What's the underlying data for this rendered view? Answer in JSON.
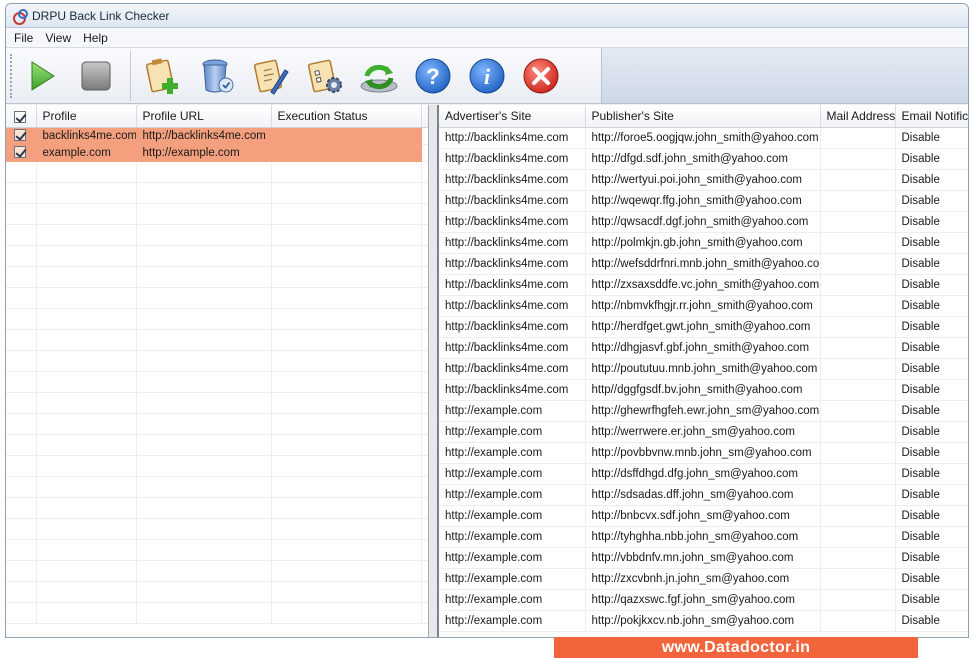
{
  "window": {
    "title": "DRPU Back Link Checker"
  },
  "menu": [
    "File",
    "View",
    "Help"
  ],
  "toolbar": {
    "buttons": [
      {
        "icon": "play-icon",
        "name": "start-button"
      },
      {
        "icon": "stop-icon",
        "name": "stop-button"
      },
      {
        "icon": "add-profile-icon",
        "name": "add-profile-button"
      },
      {
        "icon": "delete-profile-icon",
        "name": "delete-profile-button"
      },
      {
        "icon": "edit-profile-icon",
        "name": "edit-profile-button"
      },
      {
        "icon": "settings-icon",
        "name": "settings-button"
      },
      {
        "icon": "refresh-icon",
        "name": "refresh-button"
      },
      {
        "icon": "help-icon",
        "name": "help-button"
      },
      {
        "icon": "info-icon",
        "name": "about-button"
      },
      {
        "icon": "close-icon",
        "name": "exit-button"
      }
    ]
  },
  "profiles": {
    "columns": [
      "Profile",
      "Profile URL",
      "Execution Status"
    ],
    "rows": [
      {
        "checked": true,
        "profile": "backlinks4me.com",
        "url": "http://backlinks4me.com",
        "status": ""
      },
      {
        "checked": true,
        "profile": "example.com",
        "url": "http://example.com",
        "status": ""
      }
    ]
  },
  "results": {
    "columns": [
      "Advertiser's Site",
      "Publisher's Site",
      "Mail Address",
      "Email Notific..."
    ],
    "rows": [
      [
        "http://backlinks4me.com",
        "http://foroe5.oogjqw.john_smith@yahoo.com",
        "",
        "Disable"
      ],
      [
        "http://backlinks4me.com",
        "http://dfgd.sdf.john_smith@yahoo.com",
        "",
        "Disable"
      ],
      [
        "http://backlinks4me.com",
        "http://wertyui.poi.john_smith@yahoo.com",
        "",
        "Disable"
      ],
      [
        "http://backlinks4me.com",
        "http://wqewqr.ffg.john_smith@yahoo.com",
        "",
        "Disable"
      ],
      [
        "http://backlinks4me.com",
        "http://qwsacdf.dgf.john_smith@yahoo.com",
        "",
        "Disable"
      ],
      [
        "http://backlinks4me.com",
        "http://polmkjn.gb.john_smith@yahoo.com",
        "",
        "Disable"
      ],
      [
        "http://backlinks4me.com",
        "http://wefsddrfnri.mnb.john_smith@yahoo.com",
        "",
        "Disable"
      ],
      [
        "http://backlinks4me.com",
        "http://zxsaxsddfe.vc.john_smith@yahoo.com",
        "",
        "Disable"
      ],
      [
        "http://backlinks4me.com",
        "http://nbmvkfhgjr.rr.john_smith@yahoo.com",
        "",
        "Disable"
      ],
      [
        "http://backlinks4me.com",
        "http://herdfget.gwt.john_smith@yahoo.com",
        "",
        "Disable"
      ],
      [
        "http://backlinks4me.com",
        "http://dhgjasvf.gbf.john_smith@yahoo.com",
        "",
        "Disable"
      ],
      [
        "http://backlinks4me.com",
        "http://poututuu.mnb.john_smith@yahoo.com",
        "",
        "Disable"
      ],
      [
        "http://backlinks4me.com",
        "http//dggfgsdf.bv.john_smith@yahoo.com",
        "",
        "Disable"
      ],
      [
        "http://example.com",
        "http://ghewrfhgfeh.ewr.john_sm@yahoo.com",
        "",
        "Disable"
      ],
      [
        "http://example.com",
        "http://werrwere.er.john_sm@yahoo.com",
        "",
        "Disable"
      ],
      [
        "http://example.com",
        "http://povbbvnw.mnb.john_sm@yahoo.com",
        "",
        "Disable"
      ],
      [
        "http://example.com",
        "http://dsffdhgd.dfg.john_sm@yahoo.com",
        "",
        "Disable"
      ],
      [
        "http://example.com",
        "http://sdsadas.dff.john_sm@yahoo.com",
        "",
        "Disable"
      ],
      [
        "http://example.com",
        "http://bnbcvx.sdf.john_sm@yahoo.com",
        "",
        "Disable"
      ],
      [
        "http://example.com",
        "http://tyhghha.nbb.john_sm@yahoo.com",
        "",
        "Disable"
      ],
      [
        "http://example.com",
        "http://vbbdnfv.mn.john_sm@yahoo.com",
        "",
        "Disable"
      ],
      [
        "http://example.com",
        "http://zxcvbnh.jn.john_sm@yahoo.com",
        "",
        "Disable"
      ],
      [
        "http://example.com",
        "http://qazxswc.fgf.john_sm@yahoo.com",
        "",
        "Disable"
      ],
      [
        "http://example.com",
        "http://pokjkxcv.nb.john_sm@yahoo.com",
        "",
        "Disable"
      ]
    ]
  },
  "brand": {
    "text": "www.Datadoctor.in"
  },
  "colors": {
    "selection": "#f4a07e",
    "brand": "#f2643c"
  }
}
